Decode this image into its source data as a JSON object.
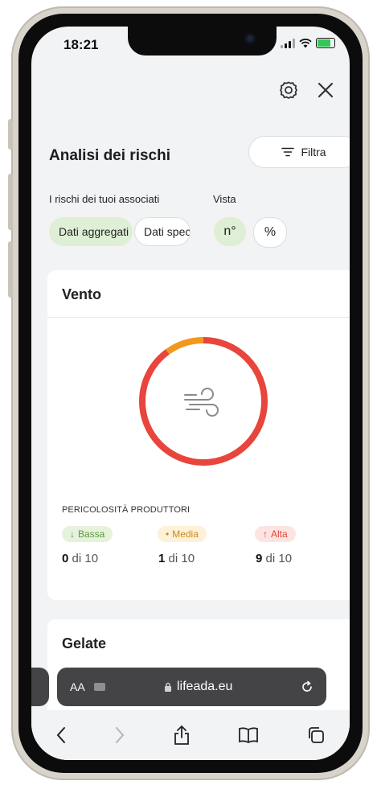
{
  "status": {
    "time": "18:21"
  },
  "header": {
    "settings_icon": "gear-icon",
    "close_icon": "close-icon"
  },
  "page": {
    "title": "Analisi dei rischi",
    "filter_label": "Filtra"
  },
  "filters": {
    "associates_label": "I rischi dei tuoi associati",
    "view_label": "Vista",
    "chip_aggregated": "Dati aggregati",
    "chip_specific": "Dati specifici",
    "chip_count": "n°",
    "chip_percent": "%"
  },
  "risk_card": {
    "title": "Vento",
    "danger_label": "PERICOLOSITÀ PRODUTTORI",
    "levels": [
      {
        "label": "Bassa",
        "value": "0",
        "suffix": "di 10",
        "color": "#5a9a3a",
        "bg": "#e6f2dc"
      },
      {
        "label": "Media",
        "value": "1",
        "suffix": "di 10",
        "color": "#c88a1a",
        "bg": "#fdf1d9"
      },
      {
        "label": "Alta",
        "value": "9",
        "suffix": "di 10",
        "color": "#e0453a",
        "bg": "#fde4e2"
      }
    ],
    "donut": {
      "high_fraction": 0.9,
      "medium_fraction": 0.1,
      "high_color": "#e8453c",
      "medium_color": "#f3981e"
    }
  },
  "second_card": {
    "title": "Gelate"
  },
  "safari": {
    "text_size": "AA",
    "url": "lifeada.eu"
  },
  "colors": {
    "accent_green": "#deefd5",
    "background": "#f2f3f4"
  }
}
